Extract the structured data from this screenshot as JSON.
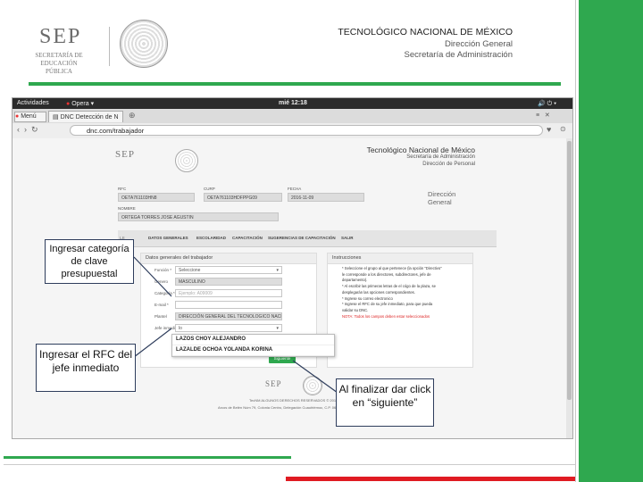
{
  "slide": {
    "sep_logo": "SEP",
    "sep_sub": "SECRETARÍA DE EDUCACIÓN PÚBLICA",
    "title": "TECNOLÓGICO NACIONAL DE MÉXICO",
    "line1": "Dirección General",
    "line2": "Secretaría de Administración"
  },
  "browser": {
    "activities": "Actividades",
    "app": "Opera",
    "clock": "mié 12:18",
    "menu": "Menú",
    "tab": "DNC Detección de N",
    "url": "dnc.com/trabajador"
  },
  "page": {
    "header_title": "Tecnológico Nacional de México",
    "header_l1": "Secretaría de Administración",
    "header_l2": "Dirección de Personal",
    "side_title": "Dirección General",
    "sep": "SEP",
    "labels": {
      "rfc": "RFC",
      "curp": "CURP",
      "fecha": "FECHA",
      "nombre": "NOMBRE"
    },
    "values": {
      "rfc": "OETA761103HN8",
      "curp": "OETA761103HDFPPG09",
      "fecha": "2016-11-09",
      "nombre": "ORTEGA TORRES JOSE AGUSTIN"
    },
    "tabs": [
      "DATOS GENERALES",
      "ESCOLARIDAD",
      "CAPACITACIÓN",
      "SUGERENCIAS DE CAPACITACIÓN",
      "SALIR"
    ],
    "tab_prefix": "LE",
    "form_title": "Datos generales del trabajador",
    "form": {
      "funcion_label": "Función *",
      "funcion_value": "Seleccione",
      "genero_label": "Genero",
      "genero_value": "MASCULINO",
      "categoria_label": "Categoría *",
      "categoria_placeholder": "Ejemplo: A09009",
      "email_label": "E-mail *",
      "plantel_label": "Plantel",
      "plantel_value": "DIRECCIÓN GENERAL DEL TECNOLOGICO NACIONAL",
      "jefe_label": "Jefe inmediato",
      "jefe_value": "lo",
      "suggestions": [
        "LAZOS CHOY ALEJANDRO",
        "LAZALDE OCHOA YOLANDA KORINA"
      ],
      "next": "Siguiente"
    },
    "instr_title": "Instrucciones",
    "instructions": [
      "* Seleccione el grupo al que pertenece (la opción \"Directivo\"",
      "le corresponde a los directores, subdirectores, jefe de",
      "departamento).",
      "* Al escribir las primeras letras de el cógo de la plaza, se",
      "desplegarán las opciones correspondientes.",
      "* Ingrese su correo electronico",
      "* Ingrese el RFC de su jefe inmediato, para que pueda",
      "validar su DNC.",
      "NOTA: Todos los campos deben estar seleccionados"
    ],
    "footer1": "TecNM ALGUNOS DERECHOS RESERVADOS © 2016 - 20",
    "footer2": "Arcos de Belén Núm 79, Colonia Centro, Delegación Cuauhtémoc, C.P. 06080, México, D.F."
  },
  "callouts": {
    "categoria": "Ingresar categoría de clave presupuestal",
    "rfc_jefe": "Ingresar el RFC del jefe inmediato",
    "siguiente": "Al finalizar dar click en “siguiente”"
  },
  "colors": {
    "green": "#2fa84f",
    "red": "#e01b22",
    "callout_border": "#2e3d5c"
  }
}
